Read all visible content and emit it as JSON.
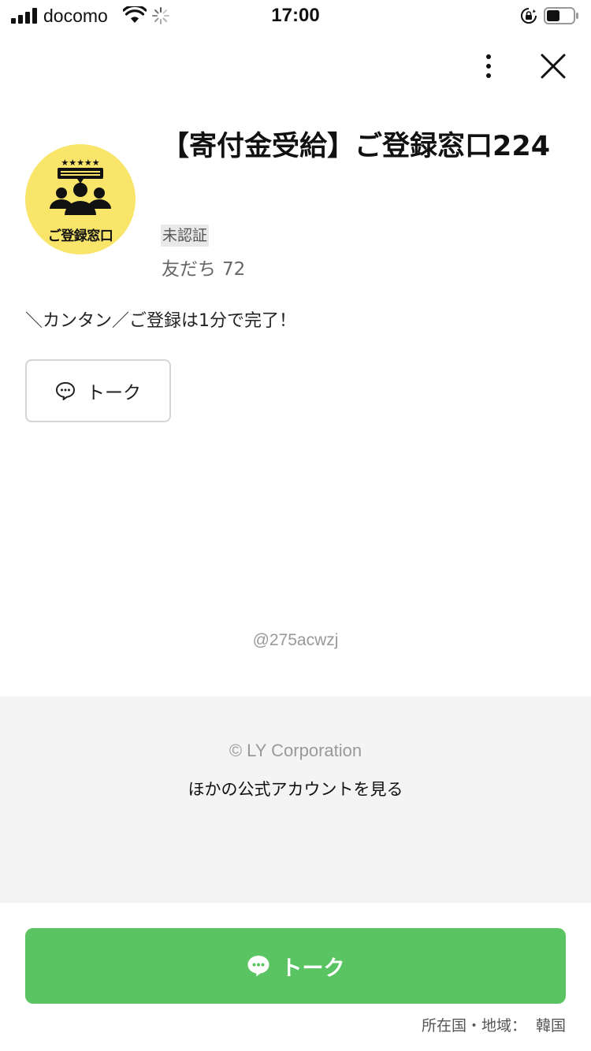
{
  "status_bar": {
    "carrier": "docomo",
    "time": "17:00"
  },
  "header": {
    "more_icon": "more-vertical-icon",
    "close_icon": "close-icon"
  },
  "profile": {
    "avatar_text": "ご登録窓口",
    "avatar_bg": "#f8e56a",
    "title": "【寄付金受給】ご登録窓口224",
    "verification": "未認証",
    "friends_label": "友だち",
    "friends_count": "72",
    "description": "＼カンタン／ご登録は1分で完了！"
  },
  "talk_button": {
    "label": "トーク",
    "icon": "chat-bubble-icon"
  },
  "account_id": "@275acwzj",
  "footer": {
    "copyright": "© LY Corporation",
    "other_accounts": "ほかの公式アカウントを見る"
  },
  "main_button": {
    "label": "トーク",
    "color": "#5ac462",
    "icon": "chat-bubble-icon"
  },
  "region": {
    "label": "所在国・地域：",
    "value": "韓国"
  }
}
